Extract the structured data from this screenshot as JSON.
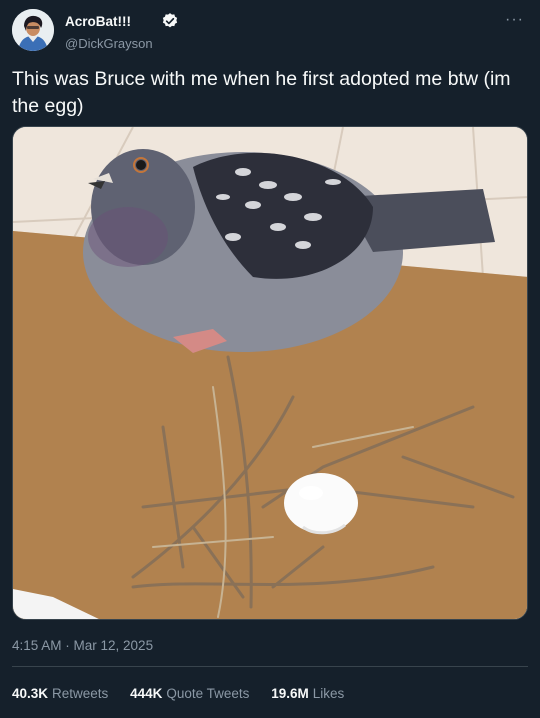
{
  "author": {
    "display_name": "AcroBat!!!",
    "handle": "@DickGrayson",
    "verified": true,
    "avatar_icon": "avatar-illustration"
  },
  "more_icon": "more-horizontal-icon",
  "tweet": {
    "text": "This was Bruce with me when he first adopted me btw (im the egg)",
    "media_description": "pigeon-beside-egg-on-doormat"
  },
  "meta": {
    "timestamp": "4:15 AM · Mar 12, 2025"
  },
  "stats": {
    "retweets_count": "40.3K",
    "retweets_label": "Retweets",
    "quotes_count": "444K",
    "quotes_label": "Quote Tweets",
    "likes_count": "19.6M",
    "likes_label": "Likes"
  },
  "colors": {
    "background": "#15202b",
    "text_primary": "#f7f9f9",
    "text_secondary": "#8b98a5",
    "verified": "#f7f9f9",
    "divider": "#38444d"
  }
}
